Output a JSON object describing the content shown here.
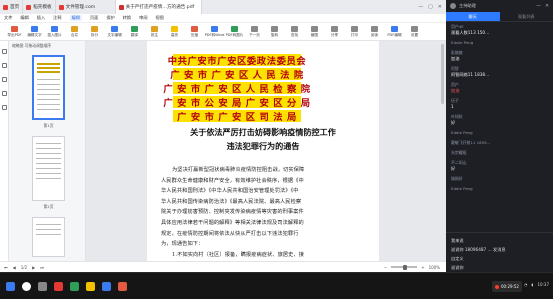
{
  "tabs": [
    {
      "label": "首页",
      "color": "#e53935"
    },
    {
      "label": "稻壳模板",
      "color": "#e53935"
    },
    {
      "label": "文件管理.com",
      "color": "#e53935"
    },
    {
      "label": "关于严打违严疫情…方的通告.pdf",
      "color": "#d0312d"
    }
  ],
  "menu": [
    "文件",
    "编辑",
    "插入",
    "注释",
    "编辑",
    "页面",
    "保护",
    "转换",
    "审阅",
    "视图"
  ],
  "toolbar": [
    {
      "label": "导出PDF",
      "icon": "export-icon",
      "color": "#e25a40"
    },
    {
      "label": "编辑文字",
      "icon": "edit-text-icon",
      "color": "#3b7bf0"
    },
    {
      "label": "插入图片",
      "icon": "image-icon",
      "color": "#3b7bf0"
    },
    {
      "label": "合并",
      "icon": "merge-icon",
      "color": "#e0a020"
    },
    {
      "label": "拆分",
      "icon": "split-icon",
      "color": "#e0a020"
    },
    {
      "label": "文字编辑",
      "icon": "text-icon",
      "color": "#3b7bf0"
    },
    {
      "label": "翻译",
      "icon": "translate-icon",
      "color": "#2e9e58"
    },
    {
      "label": "批注",
      "icon": "comment-icon",
      "color": "#e0a020"
    },
    {
      "label": "高亮",
      "icon": "highlight-icon",
      "color": "#f2c200"
    },
    {
      "label": "压缩",
      "icon": "compress-icon",
      "color": "#e25a40"
    },
    {
      "label": "PDF转Word",
      "icon": "pdf2word-icon",
      "color": "#3b7bf0"
    },
    {
      "label": "PDF转图片",
      "icon": "pdf2img-icon",
      "color": "#2e9e58"
    },
    {
      "label": "下一页",
      "icon": "next-page-icon",
      "color": "#888888"
    },
    {
      "label": "旋转",
      "icon": "rotate-icon",
      "color": "#888888"
    },
    {
      "label": "查找",
      "icon": "search-icon",
      "color": "#888888"
    },
    {
      "label": "截图",
      "icon": "screenshot-icon",
      "color": "#888888"
    },
    {
      "label": "分享",
      "icon": "share-icon",
      "color": "#888888"
    },
    {
      "label": "打印",
      "icon": "print-icon",
      "color": "#888888"
    },
    {
      "label": "阅读",
      "icon": "read-icon",
      "color": "#888888"
    },
    {
      "label": "PDF编辑",
      "icon": "pdf-edit-icon",
      "color": "#3b7bf0"
    },
    {
      "label": "设置",
      "icon": "settings-icon",
      "color": "#888888"
    }
  ],
  "thumb_panel": {
    "title": "缩略图  可拖动调整顺序",
    "pages": [
      "第1页",
      "第2页"
    ]
  },
  "document": {
    "header_lines": [
      "中共广安市广安区委政法委员会",
      "广 安 市 广 安 区 人 民 法 院",
      "广 安 市 广 安 区 人 民 检 察 院",
      "广 安 市 公 安 局 广 安 区 分 局",
      "广 安 市 广 安 区 司 法 局"
    ],
    "title_lines": [
      "关于依法严厉打击妨碍影响疫情防控工作",
      "违法犯罪行为的通告"
    ],
    "body_lines": [
      "为坚决打赢新型冠状病毒肺炎疫情防控阻击战，切实保障",
      "人民群众生命健康和财产安全，有效维护社会秩序，根据《中",
      "华人民共和国刑法》《中华人民共和国治安管理处罚法》《中",
      "华人民共和国传染病防治法》《最高人民法院、最高人民检察",
      "院关于办理妨害预防、控制突发传染病疫情等灾害的刑事案件",
      "具体应用法律若干问题的解释》等相关法律法规及司法解释的",
      "规定，在疫情防控期间将依法从快从严打击以下违法犯罪行",
      "为，现通告如下：",
      "1.不如实向村（社区）报备，瞒报疫病症状、旅居史、接"
    ]
  },
  "statusbar": {
    "page": "1/2",
    "zoom": "100%"
  },
  "side_panel": {
    "user": "主持助理",
    "tabs": [
      "聊天",
      "观看列表"
    ],
    "messages": [
      {
        "name": "用户4E",
        "text": "观看人数113  150…",
        "hot": false
      },
      {
        "name": "Edslie Peng",
        "text": "",
        "hot": false
      },
      {
        "name": "彩旗旗",
        "text": "加油",
        "hot": false
      },
      {
        "name": "阿智",
        "text": "阿智网络11  1838…",
        "hot": false
      },
      {
        "name": "用户",
        "text": "加油",
        "hot": true
      },
      {
        "name": "伍子",
        "text": "1",
        "hot": false
      },
      {
        "name": "叶知秋",
        "text": "好",
        "hot": false
      },
      {
        "name": "Eddie Peng",
        "text": "",
        "hot": false
      },
      {
        "name": "戴敏飞开前11  1859…",
        "text": "",
        "hot": false
      },
      {
        "name": "光宗耀祖",
        "text": "",
        "hot": false
      },
      {
        "name": "不二如山",
        "text": "好",
        "hot": false
      },
      {
        "name": "刚刚好",
        "text": "",
        "hot": false
      },
      {
        "name": "Eddie Peng",
        "text": "",
        "hot": false
      }
    ],
    "input_rows": [
      "我来说",
      "说说你   18096487 … 发消息",
      "自定义",
      "说说你"
    ]
  },
  "taskbar": {
    "recording": "00:29:52",
    "clock": "10:37"
  }
}
